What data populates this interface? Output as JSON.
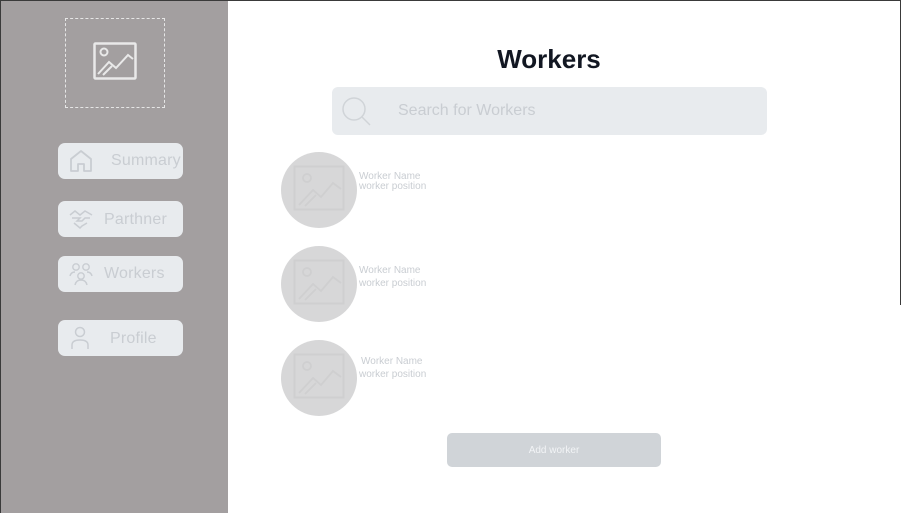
{
  "page": {
    "title": "Workers"
  },
  "sidebar": {
    "logo_icon": "image-placeholder-icon",
    "items": [
      {
        "label": "Summary",
        "icon": "home-icon"
      },
      {
        "label": "Parthner",
        "icon": "handshake-icon"
      },
      {
        "label": "Workers",
        "icon": "users-icon"
      },
      {
        "label": "Profile",
        "icon": "user-icon"
      }
    ]
  },
  "search": {
    "placeholder": "Search for Workers",
    "value": "",
    "icon": "search-icon"
  },
  "workers": [
    {
      "name": "Worker Name",
      "position": "worker position",
      "avatar_icon": "image-placeholder-icon"
    },
    {
      "name": "Worker Name",
      "position": "worker position",
      "avatar_icon": "image-placeholder-icon"
    },
    {
      "name": "Worker Name",
      "position": "worker position",
      "avatar_icon": "image-placeholder-icon"
    }
  ],
  "actions": {
    "add_worker_label": "Add worker"
  },
  "colors": {
    "sidebar_bg": "#a39fa0",
    "nav_item_bg": "#e8ebee",
    "muted_text": "#c9cdd2",
    "title_text": "#121722",
    "avatar_bg": "#d7d7d8",
    "button_bg": "#d0d4d8"
  }
}
